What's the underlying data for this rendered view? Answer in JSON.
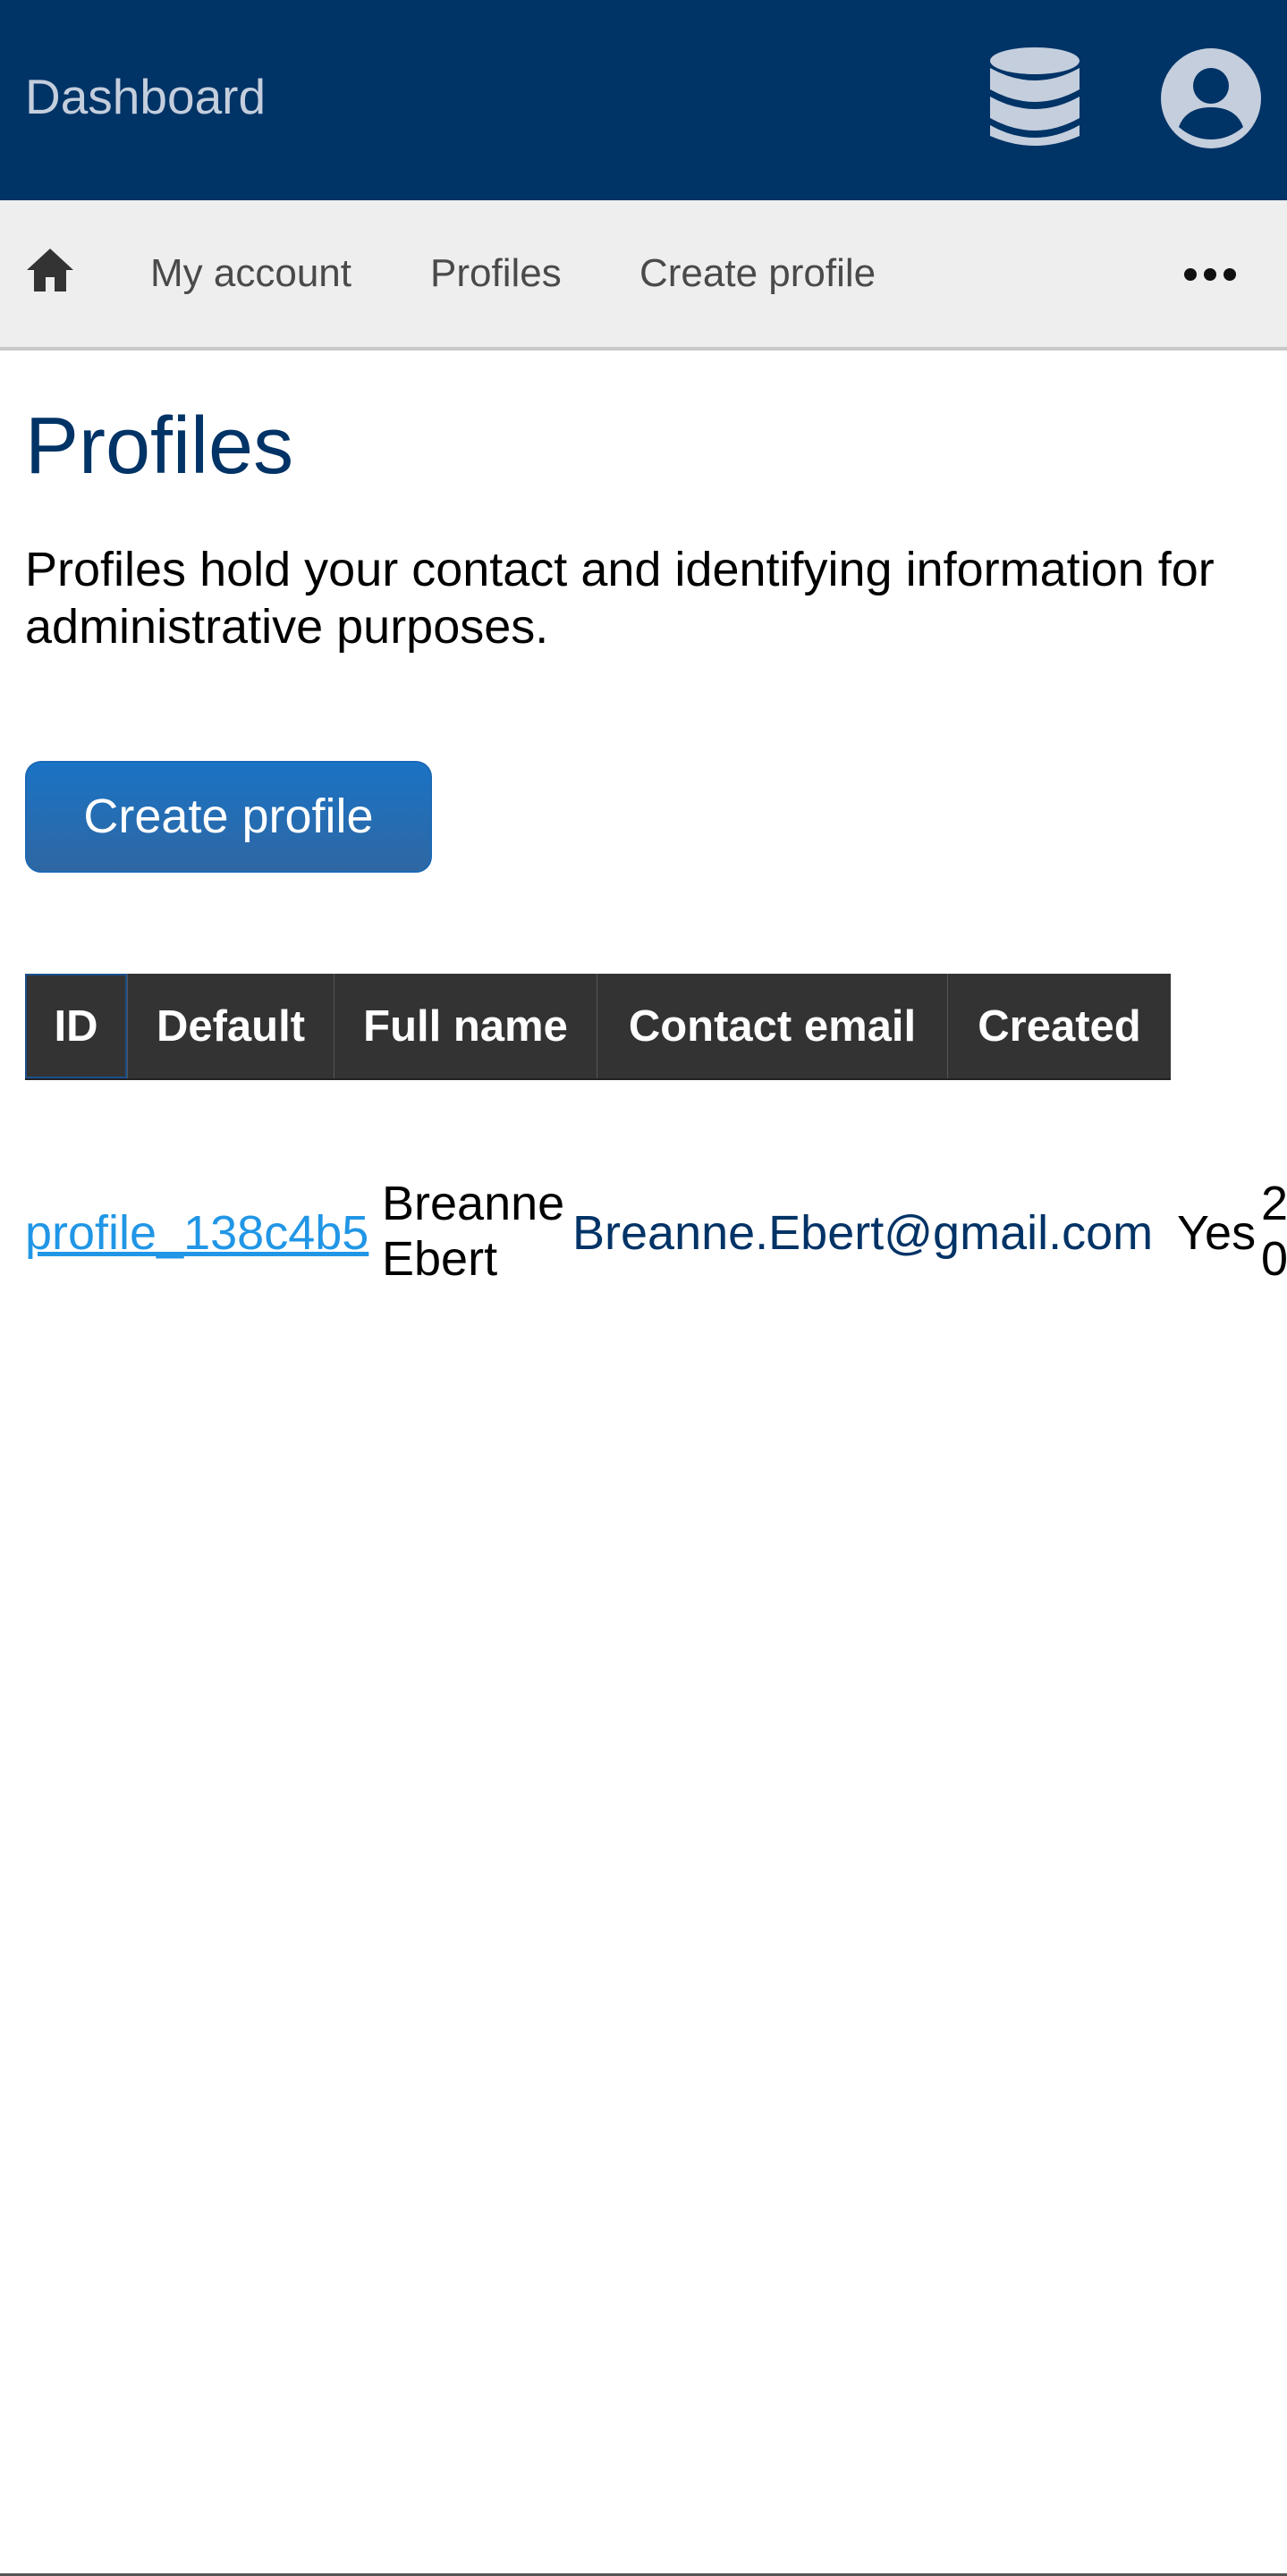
{
  "header": {
    "title": "Dashboard",
    "database_icon": "database-icon",
    "account_icon": "account-circle-icon",
    "background_color": "#003366"
  },
  "navbar": {
    "home_icon": "home-icon",
    "items": [
      {
        "label": "My account"
      },
      {
        "label": "Profiles"
      },
      {
        "label": "Create profile"
      }
    ],
    "more_icon": "more-horizontal-icon"
  },
  "page": {
    "title": "Profiles",
    "description": "Profiles hold your contact and identifying information for administrative purposes.",
    "create_button_label": "Create profile"
  },
  "table": {
    "headers": [
      "ID",
      "Default",
      "Full name",
      "Contact email",
      "Created"
    ],
    "rows": [
      {
        "id": "profile_138c4b5",
        "full_name": "Breanne Ebert",
        "contact_email": "Breanne.Ebert@gmail.com",
        "default": "Yes",
        "created": "2 0"
      }
    ]
  },
  "colors": {
    "accent": "#1a73c4",
    "link": "#2196e6",
    "title": "#003366"
  }
}
